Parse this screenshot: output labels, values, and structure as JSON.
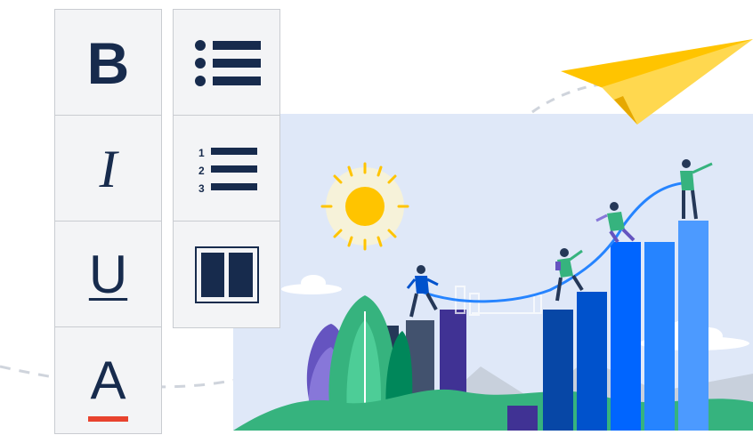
{
  "toolbar": {
    "bold_label": "B",
    "italic_label": "I",
    "underline_label": "U",
    "text_color_label": "A",
    "text_color_swatch": "#e8432e",
    "numbered_markers": [
      "1",
      "2",
      "3"
    ]
  },
  "icons": {
    "bulleted_list": "bulleted-list-icon",
    "numbered_list": "numbered-list-icon",
    "layout": "two-column-layout-icon"
  },
  "colors": {
    "icon_ink": "#172b4d",
    "button_bg": "#f3f4f6",
    "button_border": "#c9ccd1",
    "sky": "#dfe8f8",
    "sun": "#ffc400",
    "plane": "#ffc400",
    "rope": "#2684ff"
  }
}
